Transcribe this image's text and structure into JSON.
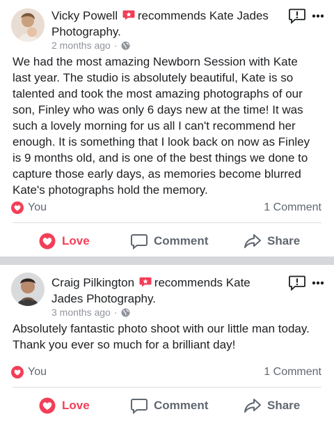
{
  "posts": [
    {
      "author": "Vicky Powell",
      "action_text": "recommends Kate Jades",
      "action_text_line2": "Photography.",
      "timestamp": "2 months ago",
      "separator_dot": "·",
      "body_lines": [
        "We had the most amazing Newborn Session with Kate",
        "last year.  The studio is absolutely beautiful, Kate is so",
        "talented and took the most amazing photographs of our",
        "son, Finley who was only 6 days new at the time!  It was",
        "such a lovely morning for us all I can't recommend her",
        "enough.  It is something that I look back on now as Finley",
        "is 9 months old, and is one of the best things we done to",
        "capture those early days, as memories become blurred",
        "Kate's photographs hold the memory."
      ],
      "reactions_label": "You",
      "comments_label": "1 Comment",
      "actions": {
        "love": "Love",
        "comment": "Comment",
        "share": "Share"
      }
    },
    {
      "author": "Craig Pilkington",
      "action_text": "recommends Kate",
      "action_text_line2": "Jades Photography.",
      "timestamp": "3 months ago",
      "separator_dot": "·",
      "body_lines": [
        "Absolutely fantastic photo shoot with our little man today.",
        "Thank you ever so much for a brilliant day!"
      ],
      "reactions_label": "You",
      "comments_label": "1 Comment",
      "actions": {
        "love": "Love",
        "comment": "Comment",
        "share": "Share"
      }
    }
  ],
  "colors": {
    "love_red": "#f33e58",
    "text_dark": "#1c1e21",
    "meta_grey": "#90949c",
    "action_grey": "#606770",
    "separator": "#d6d7da"
  },
  "icons": [
    "recommend-icon",
    "globe-icon",
    "report-icon",
    "more-icon",
    "love-icon",
    "comment-icon",
    "share-icon"
  ]
}
